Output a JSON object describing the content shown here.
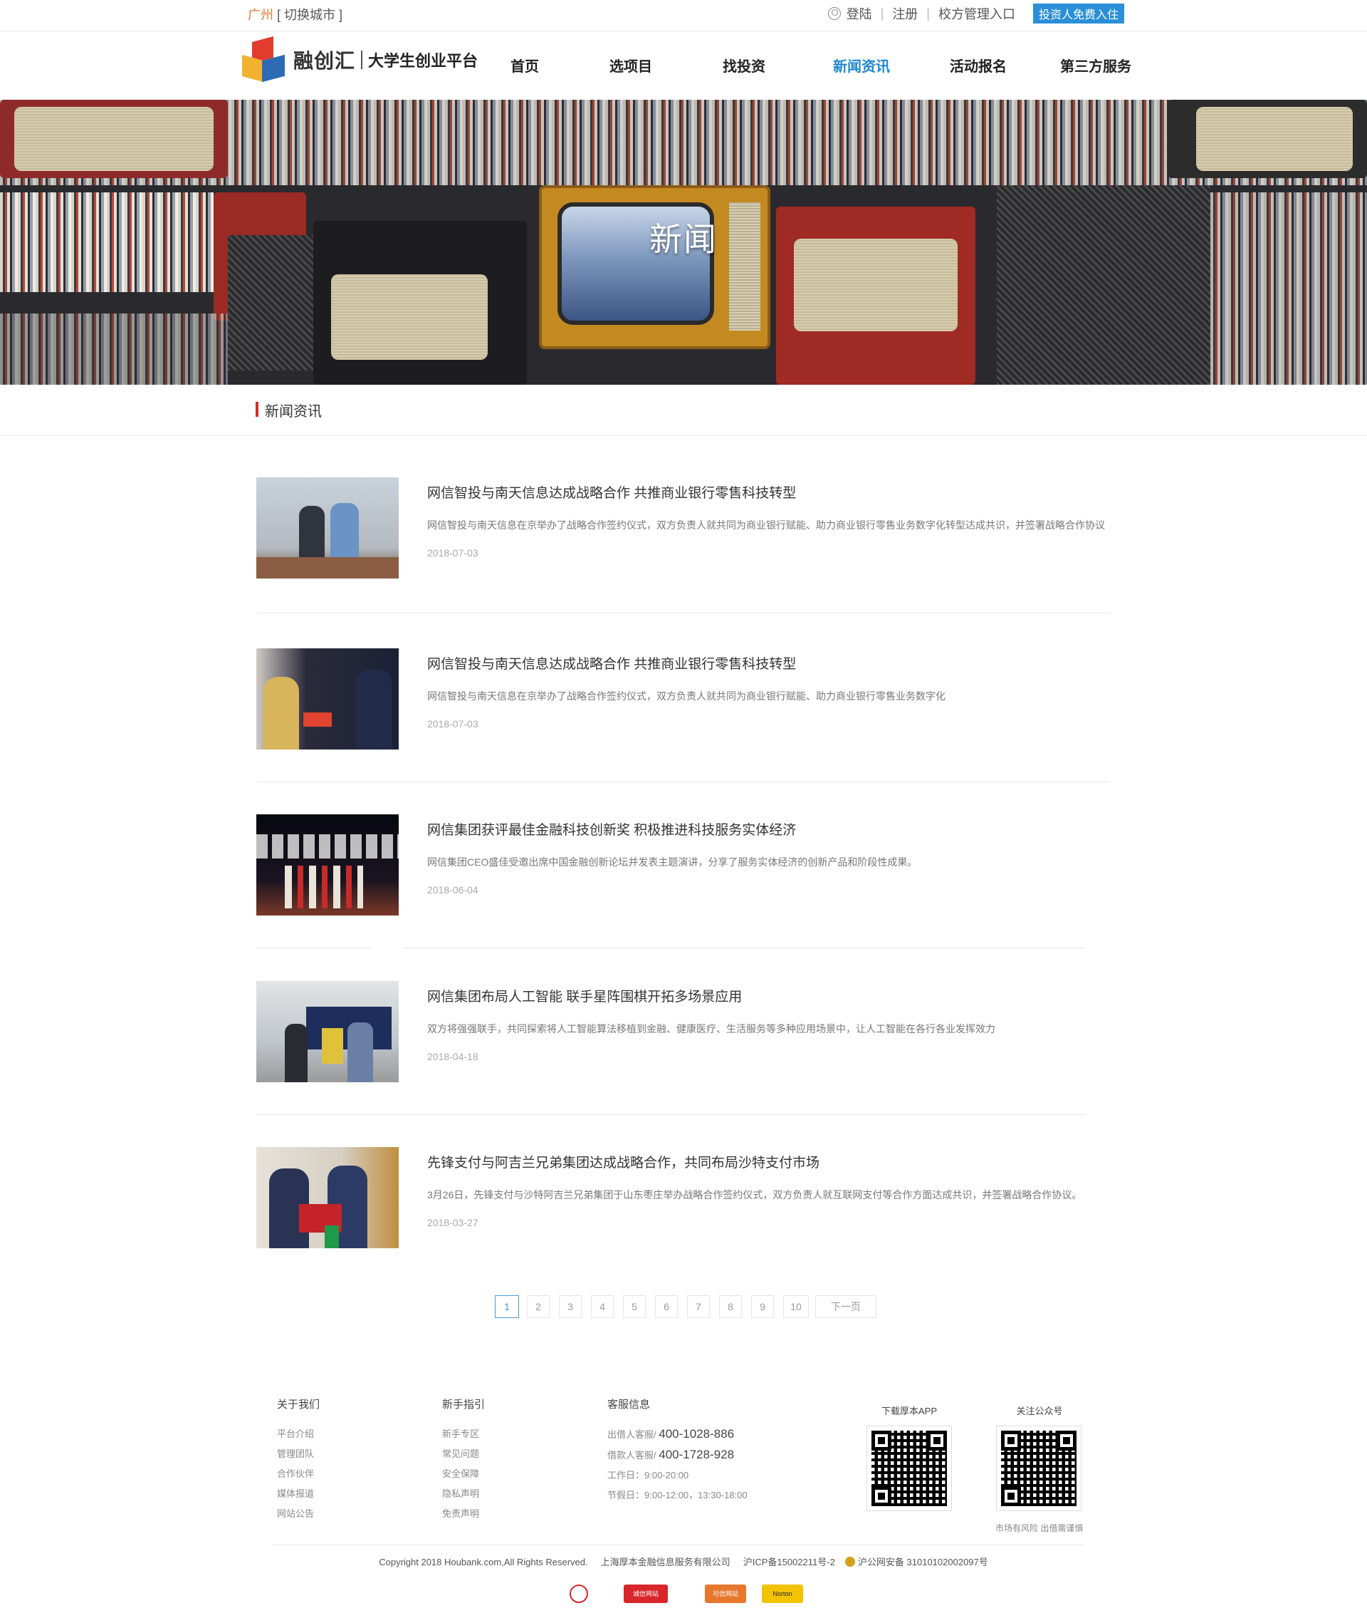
{
  "topbar": {
    "city": "广州",
    "switch_city": "[ 切换城市 ]",
    "login": "登陆",
    "register": "注册",
    "school_entry": "校方管理入口",
    "investor_btn": "投资人免费入住"
  },
  "logo": {
    "brand": "融创汇",
    "slogan": "大学生创业平台"
  },
  "nav": {
    "items": [
      {
        "label": "首页"
      },
      {
        "label": "选项目"
      },
      {
        "label": "找投资"
      },
      {
        "label": "新闻资讯",
        "active": true
      },
      {
        "label": "活动报名"
      },
      {
        "label": "第三方服务"
      }
    ],
    "active_color": "#1f86d1"
  },
  "banner": {
    "title": "新闻"
  },
  "section": {
    "title": "新闻资讯",
    "accent_color": "#d22b2b"
  },
  "news": [
    {
      "title": "网信智投与南天信息达成战略合作 共推商业银行零售科技转型",
      "desc": "网信智投与南天信息在京举办了战略合作签约仪式，双方负责人就共同为商业银行赋能、助力商业银行零售业务数字化转型达成共识，并签署战略合作协议",
      "date": "2018-07-03"
    },
    {
      "title": "网信智投与南天信息达成战略合作 共推商业银行零售科技转型",
      "desc": "网信智投与南天信息在京举办了战略合作签约仪式，双方负责人就共同为商业银行赋能、助力商业银行零售业务数字化",
      "date": "2018-07-03"
    },
    {
      "title": "网信集团获评最佳金融科技创新奖 积极推进科技服务实体经济",
      "desc": "网信集团CEO盛佳受邀出席中国金融创新论坛并发表主题演讲，分享了服务实体经济的创新产品和阶段性成果。",
      "date": "2018-06-04"
    },
    {
      "title": "网信集团布局人工智能 联手星阵围棋开拓多场景应用",
      "desc": "双方将强强联手，共同探索将人工智能算法移植到金融、健康医疗、生活服务等多种应用场景中，让人工智能在各行各业发挥效力",
      "date": "2018-04-18"
    },
    {
      "title": "先锋支付与阿吉兰兄弟集团达成战略合作，共同布局沙特支付市场",
      "desc": "3月26日，先锋支付与沙特阿吉兰兄弟集团于山东枣庄举办战略合作签约仪式，双方负责人就互联网支付等合作方面达成共识，并签署战略合作协议。",
      "date": "2018-03-27"
    }
  ],
  "pagination": {
    "pages": [
      "1",
      "2",
      "3",
      "4",
      "5",
      "6",
      "7",
      "8",
      "9",
      "10"
    ],
    "current": "1",
    "next": "下一页"
  },
  "footer": {
    "about": {
      "heading": "关于我们",
      "links": [
        "平台介绍",
        "管理团队",
        "合作伙伴",
        "媒体报道",
        "网站公告"
      ]
    },
    "guide": {
      "heading": "新手指引",
      "links": [
        "新手专区",
        "常见问题",
        "安全保障",
        "隐私声明",
        "免责声明"
      ]
    },
    "service": {
      "heading": "客服信息",
      "lender_label": "出借人客服/",
      "lender_phone": "400-1028-886",
      "borrower_label": "借款人客服/",
      "borrower_phone": "400-1728-928",
      "workday": "工作日：9:00-20:00",
      "holiday": "节假日：9:00-12:00，13:30-18:00"
    },
    "app": {
      "heading": "下载厚本APP"
    },
    "wechat": {
      "heading": "关注公众号",
      "caption": "市场有风险 出借需谨慎"
    },
    "copyright": "Copyright 2018 Houbank.com,All Rights Reserved.",
    "company": "上海厚本金融信息服务有限公司",
    "icp": "沪ICP备15002211号-2",
    "police": "沪公网安备 31010102002097号",
    "badges": [
      {
        "label": "",
        "color": "#d8262b"
      },
      {
        "label": "诚信网站",
        "color": "#d8262b"
      },
      {
        "label": "可信网站",
        "color": "#e8772e"
      },
      {
        "label": "Norton",
        "color": "#f4c300"
      }
    ]
  }
}
